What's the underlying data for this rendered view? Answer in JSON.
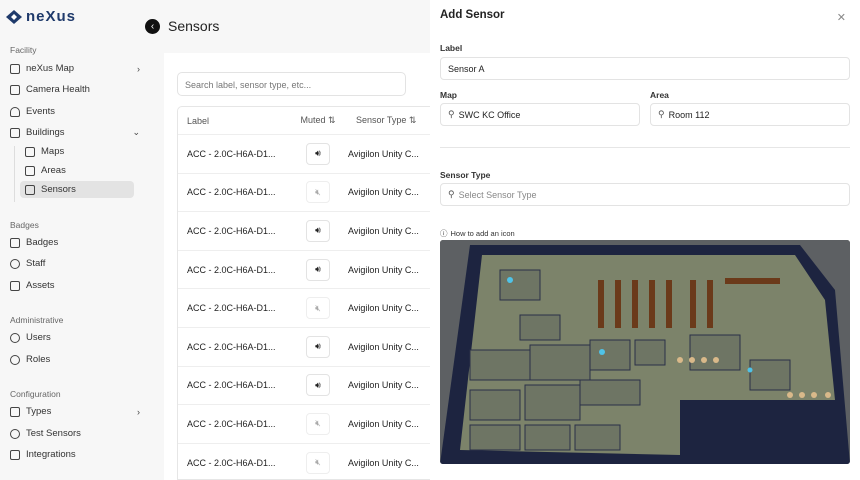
{
  "brand": "neXus",
  "sidebar": {
    "sections": [
      "Facility",
      "Badges",
      "Administrative",
      "Configuration"
    ],
    "items": [
      {
        "label": "neXus Map",
        "icon": "home-icon"
      },
      {
        "label": "Camera Health",
        "icon": "camera-icon"
      },
      {
        "label": "Events",
        "icon": "bell-icon"
      },
      {
        "label": "Buildings",
        "icon": "building-icon"
      },
      {
        "label": "Maps",
        "icon": "map-icon"
      },
      {
        "label": "Areas",
        "icon": "areas-icon"
      },
      {
        "label": "Sensors",
        "icon": "sensor-icon"
      },
      {
        "label": "Badges",
        "icon": "badge-icon"
      },
      {
        "label": "Staff",
        "icon": "staff-icon"
      },
      {
        "label": "Assets",
        "icon": "assets-icon"
      },
      {
        "label": "Users",
        "icon": "user-icon"
      },
      {
        "label": "Roles",
        "icon": "roles-icon"
      },
      {
        "label": "Types",
        "icon": "wrench-icon"
      },
      {
        "label": "Test Sensors",
        "icon": "broadcast-icon"
      },
      {
        "label": "Integrations",
        "icon": "grid-icon"
      }
    ]
  },
  "main": {
    "title": "Sensors",
    "search_placeholder": "Search label, sensor type, etc...",
    "columns": [
      "Label",
      "Muted",
      "Sensor Type"
    ],
    "rows": [
      {
        "label": "ACC - 2.0C-H6A-D1...",
        "muted": false,
        "type": "Avigilon Unity C..."
      },
      {
        "label": "ACC - 2.0C-H6A-D1...",
        "muted": true,
        "type": "Avigilon Unity C..."
      },
      {
        "label": "ACC - 2.0C-H6A-D1...",
        "muted": false,
        "type": "Avigilon Unity C..."
      },
      {
        "label": "ACC - 2.0C-H6A-D1...",
        "muted": false,
        "type": "Avigilon Unity C..."
      },
      {
        "label": "ACC - 2.0C-H6A-D1...",
        "muted": true,
        "type": "Avigilon Unity C..."
      },
      {
        "label": "ACC - 2.0C-H6A-D1...",
        "muted": false,
        "type": "Avigilon Unity C..."
      },
      {
        "label": "ACC - 2.0C-H6A-D1...",
        "muted": false,
        "type": "Avigilon Unity C..."
      },
      {
        "label": "ACC - 2.0C-H6A-D1...",
        "muted": true,
        "type": "Avigilon Unity C..."
      },
      {
        "label": "ACC - 2.0C-H6A-D1...",
        "muted": true,
        "type": "Avigilon Unity C..."
      }
    ]
  },
  "panel": {
    "title": "Add Sensor",
    "label_label": "Label",
    "label_value": "Sensor A",
    "map_label": "Map",
    "map_value": "SWC KC Office",
    "area_label": "Area",
    "area_value": "Room 112",
    "type_label": "Sensor Type",
    "type_placeholder": "Select Sensor Type",
    "howto": "How to add an icon"
  }
}
